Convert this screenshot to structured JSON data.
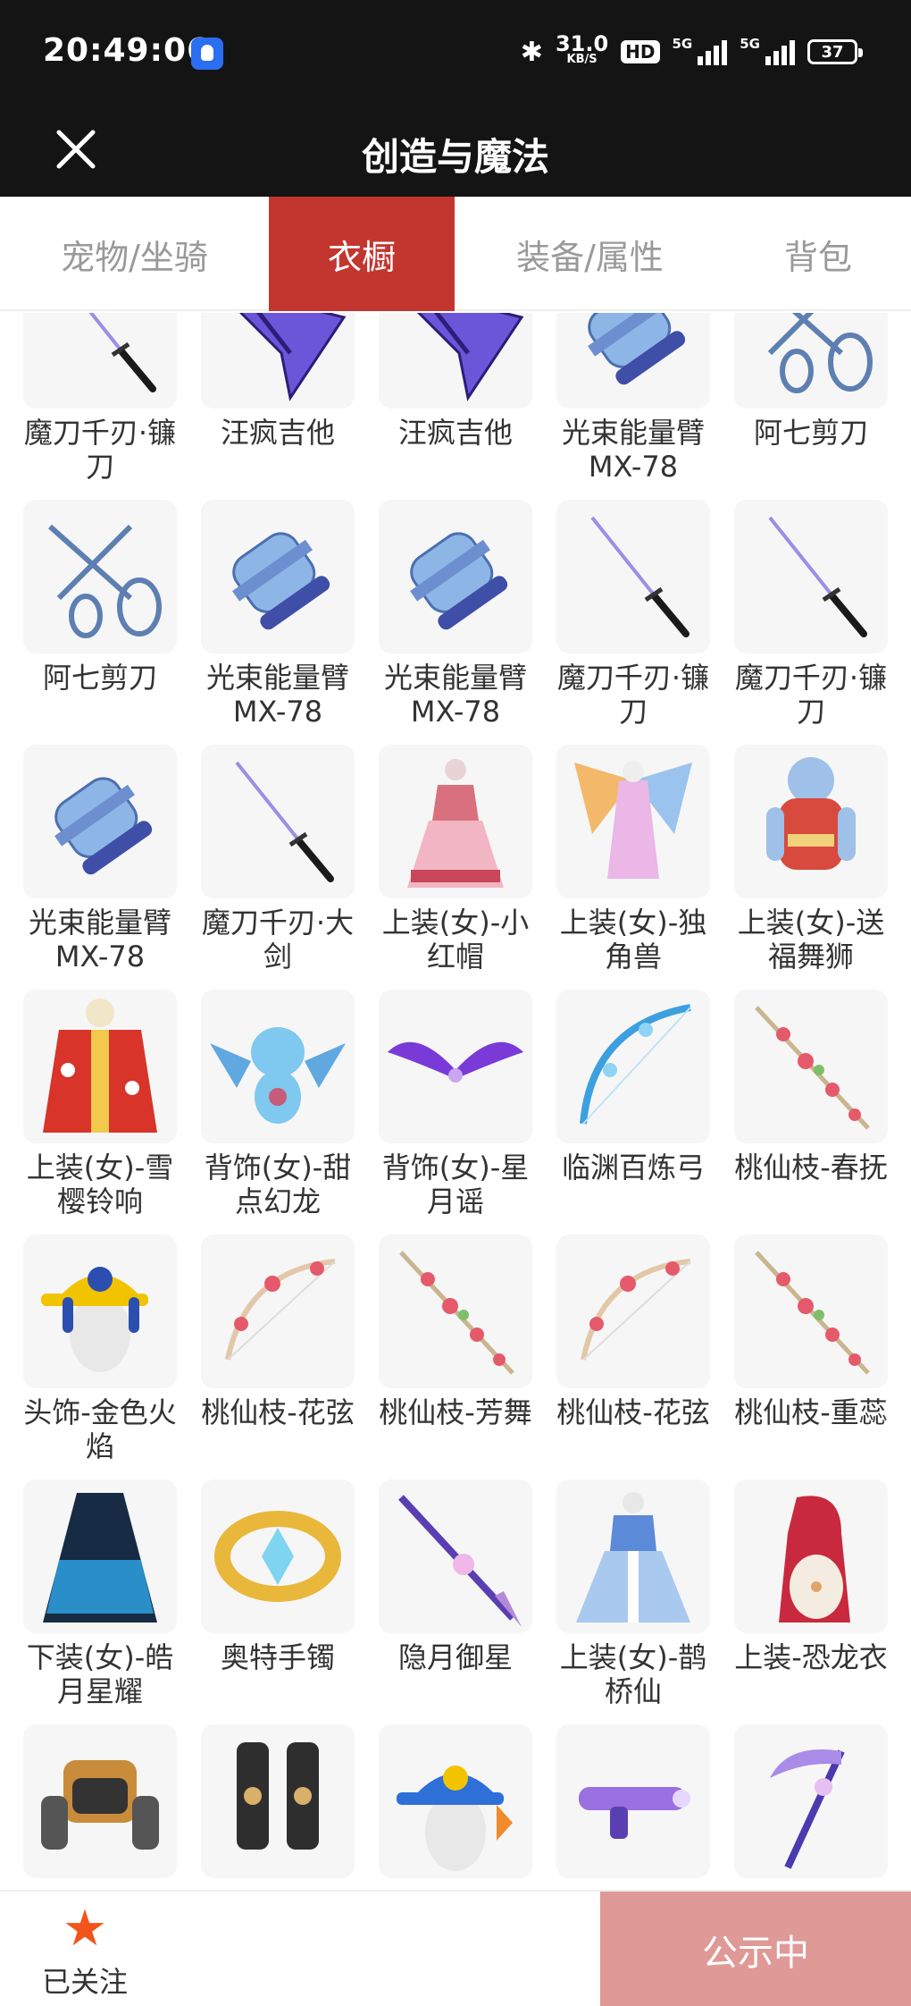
{
  "status_bar": {
    "time": "20:49:06",
    "speed_value": "31.0",
    "speed_unit": "KB/S",
    "hd": "HD",
    "net1": "5G",
    "net2": "5G",
    "battery": "37"
  },
  "header": {
    "title": "创造与魔法"
  },
  "tabs": [
    {
      "label": "宠物/坐骑",
      "active": false
    },
    {
      "label": "衣橱",
      "active": true
    },
    {
      "label": "装备/属性",
      "active": false
    },
    {
      "label": "背包",
      "active": false
    }
  ],
  "items": [
    {
      "name": "魔刀千刃·镰刀",
      "art": "blade"
    },
    {
      "name": "汪疯吉他",
      "art": "guitar"
    },
    {
      "name": "汪疯吉他",
      "art": "guitar"
    },
    {
      "name": "光束能量臂MX-78",
      "art": "arm"
    },
    {
      "name": "阿七剪刀",
      "art": "scissors"
    },
    {
      "name": "阿七剪刀",
      "art": "scissors"
    },
    {
      "name": "光束能量臂MX-78",
      "art": "arm"
    },
    {
      "name": "光束能量臂MX-78",
      "art": "arm"
    },
    {
      "name": "魔刀千刃·镰刀",
      "art": "blade"
    },
    {
      "name": "魔刀千刃·镰刀",
      "art": "blade"
    },
    {
      "name": "光束能量臂MX-78",
      "art": "arm"
    },
    {
      "name": "魔刀千刃·大剑",
      "art": "blade"
    },
    {
      "name": "上装(女)-小红帽",
      "art": "dress-pink"
    },
    {
      "name": "上装(女)-独角兽",
      "art": "wings-dress"
    },
    {
      "name": "上装(女)-送福舞狮",
      "art": "lion"
    },
    {
      "name": "上装(女)-雪樱铃响",
      "art": "red-robe"
    },
    {
      "name": "背饰(女)-甜点幻龙",
      "art": "dragon"
    },
    {
      "name": "背饰(女)-星月谣",
      "art": "purple-wings"
    },
    {
      "name": "临渊百炼弓",
      "art": "bow-blue"
    },
    {
      "name": "桃仙枝-春抚",
      "art": "branch"
    },
    {
      "name": "头饰-金色火焰",
      "art": "cap-yellow"
    },
    {
      "name": "桃仙枝-花弦",
      "art": "bow-peach"
    },
    {
      "name": "桃仙枝-芳舞",
      "art": "branch"
    },
    {
      "name": "桃仙枝-花弦",
      "art": "bow-peach"
    },
    {
      "name": "桃仙枝-重蕊",
      "art": "branch"
    },
    {
      "name": "下装(女)-皓月星耀",
      "art": "dark-dress"
    },
    {
      "name": "奥特手镯",
      "art": "bracelet"
    },
    {
      "name": "隐月御星",
      "art": "spear"
    },
    {
      "name": "上装(女)-鹊桥仙",
      "art": "blue-dress"
    },
    {
      "name": "上装-恐龙衣",
      "art": "dino"
    },
    {
      "name": "",
      "art": "mech-top"
    },
    {
      "name": "",
      "art": "mech-legs"
    },
    {
      "name": "",
      "art": "cap-blue"
    },
    {
      "name": "",
      "art": "gun"
    },
    {
      "name": "",
      "art": "scythe"
    }
  ],
  "bottom": {
    "follow_label": "已关注",
    "status_button": "公示中"
  }
}
